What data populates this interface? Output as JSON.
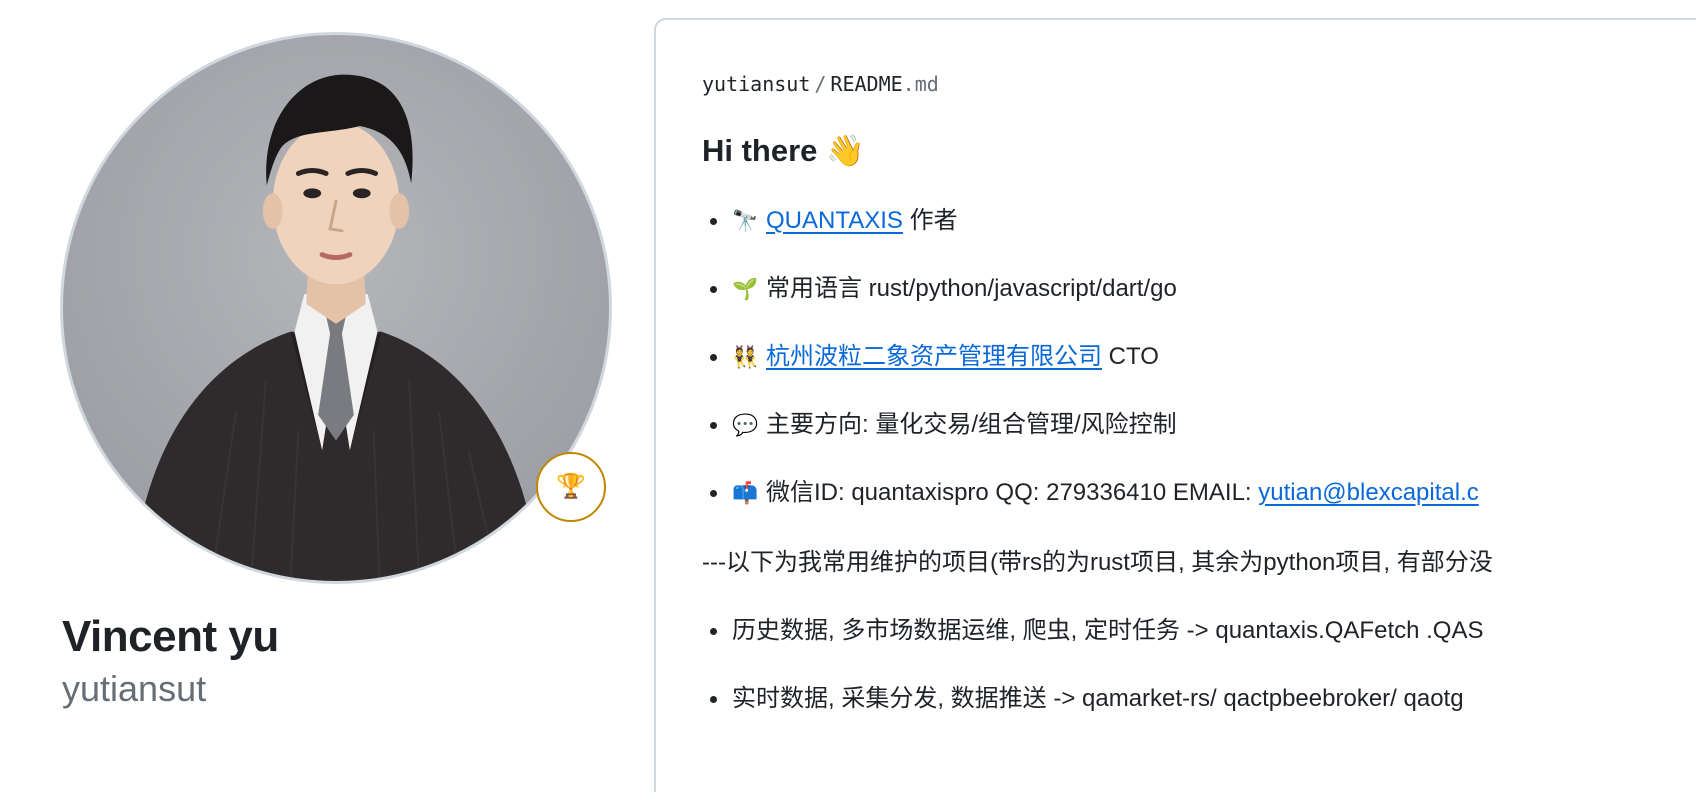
{
  "profile": {
    "full_name": "Vincent yu",
    "username": "yutiansut",
    "achievement_icon": "trophy-icon",
    "achievement_glyph": "🏆"
  },
  "readme": {
    "owner": "yutiansut",
    "separator": "/",
    "file_base": "README",
    "file_ext": ".md",
    "title": "Hi there 👋",
    "items": [
      {
        "emoji": "🔭",
        "link": "QUANTAXIS",
        "text": " 作者"
      },
      {
        "emoji": "🌱",
        "text": "常用语言 rust/python/javascript/dart/go"
      },
      {
        "emoji": "👯",
        "link": "杭州波粒二象资产管理有限公司",
        "text": " CTO"
      },
      {
        "emoji": "💬",
        "text": "主要方向: 量化交易/组合管理/风险控制"
      },
      {
        "emoji": "📫",
        "text": "微信ID: quantaxispro QQ: 279336410 EMAIL: ",
        "link": "yutian@blexcapital.c"
      }
    ],
    "projects_intro": "---以下为我常用维护的项目(带rs的为rust项目, 其余为python项目, 有部分没",
    "projects": [
      {
        "text": "历史数据, 多市场数据运维, 爬虫, 定时任务 -> quantaxis.QAFetch .QAS"
      },
      {
        "text": "实时数据, 采集分发, 数据推送 -> qamarket-rs/ qactpbeebroker/ qaotg"
      }
    ]
  },
  "colors": {
    "link": "#0969da",
    "text": "#1f2328",
    "muted": "#656d76",
    "border": "#d0d7de",
    "achievement_border": "#bf8700"
  }
}
